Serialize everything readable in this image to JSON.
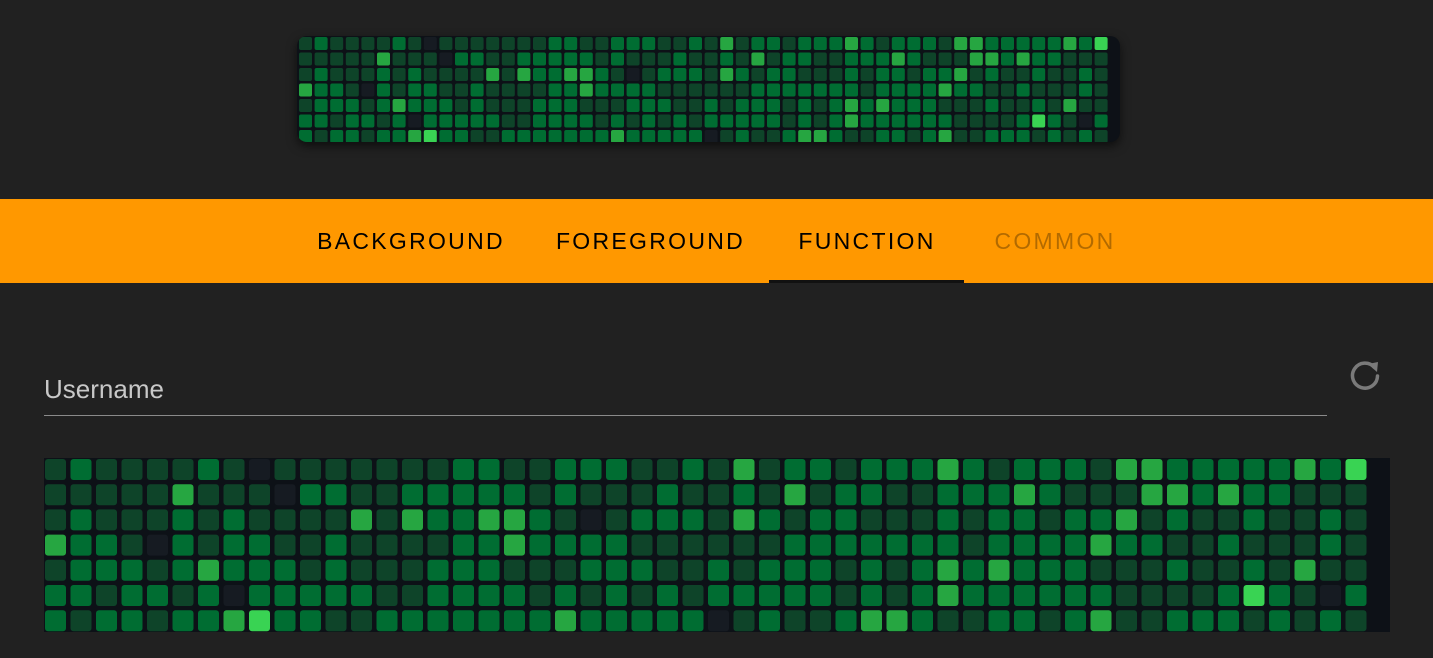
{
  "tabs": [
    {
      "label": "BACKGROUND",
      "active": false,
      "disabled": false
    },
    {
      "label": "FOREGROUND",
      "active": false,
      "disabled": false
    },
    {
      "label": "FUNCTION",
      "active": true,
      "disabled": false
    },
    {
      "label": "COMMON",
      "active": false,
      "disabled": true
    }
  ],
  "username_field": {
    "label": "Username",
    "value": ""
  },
  "refresh_button": {
    "icon": "refresh-icon"
  },
  "palette": {
    "level_colors": [
      "#161b22",
      "#0e4429",
      "#006d32",
      "#26a641",
      "#39d353"
    ],
    "grid_background": "#0d1117",
    "accent": "#ff9800"
  },
  "contribution_grid": {
    "rows": [
      "1211112101111111221122211213122122232122213322222324",
      "1111131110221122222121112112131221122232111332322111",
      "1211121211113132233210122213212211121221223121121121",
      "3221021221121111223222211111122222221222232211211121",
      "1222123222121112221112221121222121232322211121121311",
      "2212212022222112222121212122222121232222221111242102",
      "2122122342211222222232222201211233211221231122212121"
    ]
  }
}
